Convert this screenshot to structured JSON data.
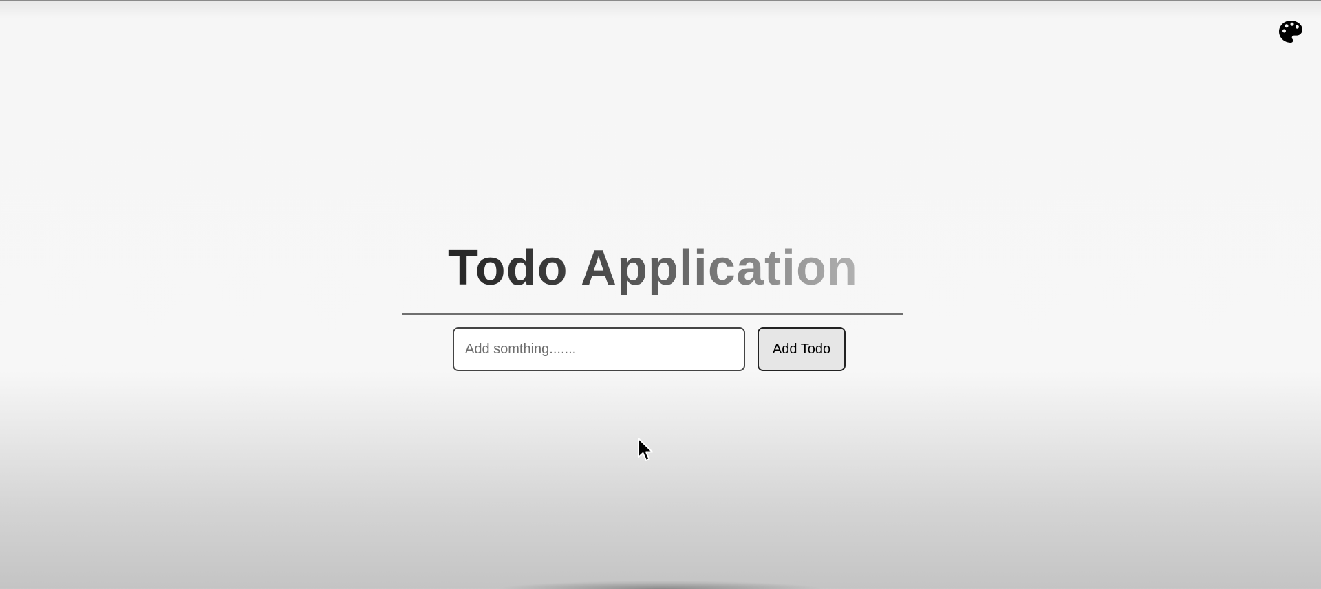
{
  "theme_toggle": {
    "icon": "palette-icon",
    "color": "#000000"
  },
  "header": {
    "title": "Todo Application"
  },
  "todo_form": {
    "input_value": "",
    "input_placeholder": "Add somthing.......",
    "add_button_label": "Add Todo"
  },
  "colors": {
    "background_top": "#f6f6f6",
    "background_bottom": "#c4c4c4",
    "title_start": "#1c1c1c",
    "title_end": "#c4c4c4",
    "divider": "#6f6f6f",
    "button_background": "#e6e6e6"
  }
}
